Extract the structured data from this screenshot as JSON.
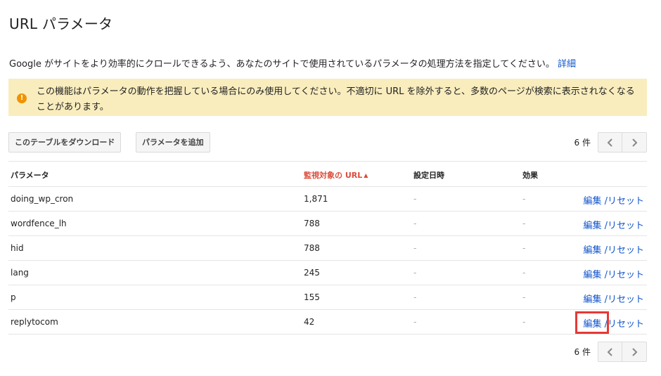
{
  "page": {
    "title": "URL パラメータ",
    "description": "Google がサイトをより効率的にクロールできるよう、あなたのサイトで使用されているパラメータの処理方法を指定してください。",
    "description_link": "詳細"
  },
  "warning": {
    "icon": "exclamation-icon",
    "text": "この機能はパラメータの動作を把握している場合にのみ使用してください。不適切に URL を除外すると、多数のページが検索に表示されなくなることがあります。"
  },
  "toolbar": {
    "download_label": "このテーブルをダウンロード",
    "add_label": "パラメータを追加"
  },
  "pagination": {
    "count_label": "6 件",
    "prev_icon": "chevron-left-icon",
    "next_icon": "chevron-right-icon"
  },
  "table": {
    "headers": {
      "param": "パラメータ",
      "count": "監視対象の URL",
      "date": "設定日時",
      "effect": "効果"
    },
    "sort_indicator": "▲",
    "rows": [
      {
        "param": "doing_wp_cron",
        "count": "1,871",
        "date": "-",
        "effect": "-",
        "edit": "編集",
        "reset": "リセット"
      },
      {
        "param": "wordfence_lh",
        "count": "788",
        "date": "-",
        "effect": "-",
        "edit": "編集",
        "reset": "リセット"
      },
      {
        "param": "hid",
        "count": "788",
        "date": "-",
        "effect": "-",
        "edit": "編集",
        "reset": "リセット"
      },
      {
        "param": "lang",
        "count": "245",
        "date": "-",
        "effect": "-",
        "edit": "編集",
        "reset": "リセット"
      },
      {
        "param": "p",
        "count": "155",
        "date": "-",
        "effect": "-",
        "edit": "編集",
        "reset": "リセット"
      },
      {
        "param": "replytocom",
        "count": "42",
        "date": "-",
        "effect": "-",
        "edit": "編集",
        "reset": "リセット"
      }
    ]
  },
  "colors": {
    "link": "#1155cc",
    "sorted_header": "#dd4b39",
    "warning_bg": "#f9edbe",
    "highlight": "#e53935"
  }
}
